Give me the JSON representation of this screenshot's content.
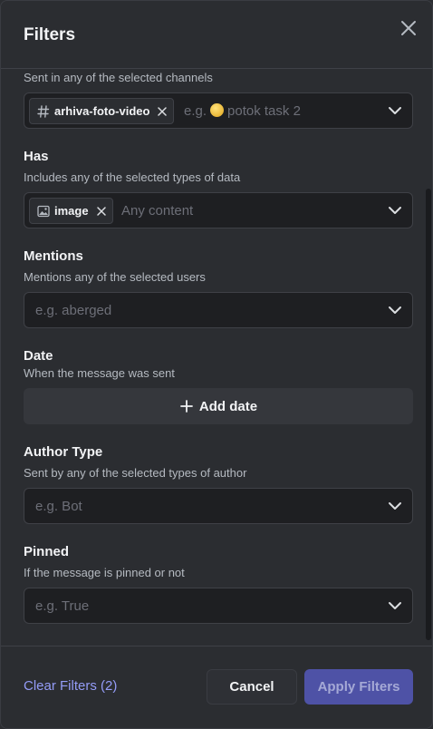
{
  "header": {
    "title": "Filters"
  },
  "icons": {
    "close": "close-icon",
    "chevron": "chevron-down-icon",
    "hash": "hash-icon",
    "image": "image-icon",
    "plus": "plus-icon"
  },
  "colors": {
    "accent": "#949cf7",
    "apply_bg": "#4e52a6",
    "background": "#2b2d31",
    "field_bg": "#1e1f22"
  },
  "channels": {
    "desc": "Sent in any of the selected channels",
    "chip_label": "arhiva-foto-video",
    "placeholder_prefix": "e.g.",
    "placeholder_suffix": "potok task 2"
  },
  "has": {
    "title": "Has",
    "desc": "Includes any of the selected types of data",
    "chip_label": "image",
    "placeholder": "Any content"
  },
  "mentions": {
    "title": "Mentions",
    "desc": "Mentions any of the selected users",
    "placeholder": "e.g. aberged"
  },
  "date": {
    "title": "Date",
    "desc": "When the message was sent",
    "button_label": "Add date"
  },
  "author_type": {
    "title": "Author Type",
    "desc": "Sent by any of the selected types of author",
    "placeholder": "e.g. Bot"
  },
  "pinned": {
    "title": "Pinned",
    "desc": "If the message is pinned or not",
    "placeholder": "e.g. True"
  },
  "footer": {
    "clear_label": "Clear Filters (2)",
    "cancel_label": "Cancel",
    "apply_label": "Apply Filters"
  }
}
